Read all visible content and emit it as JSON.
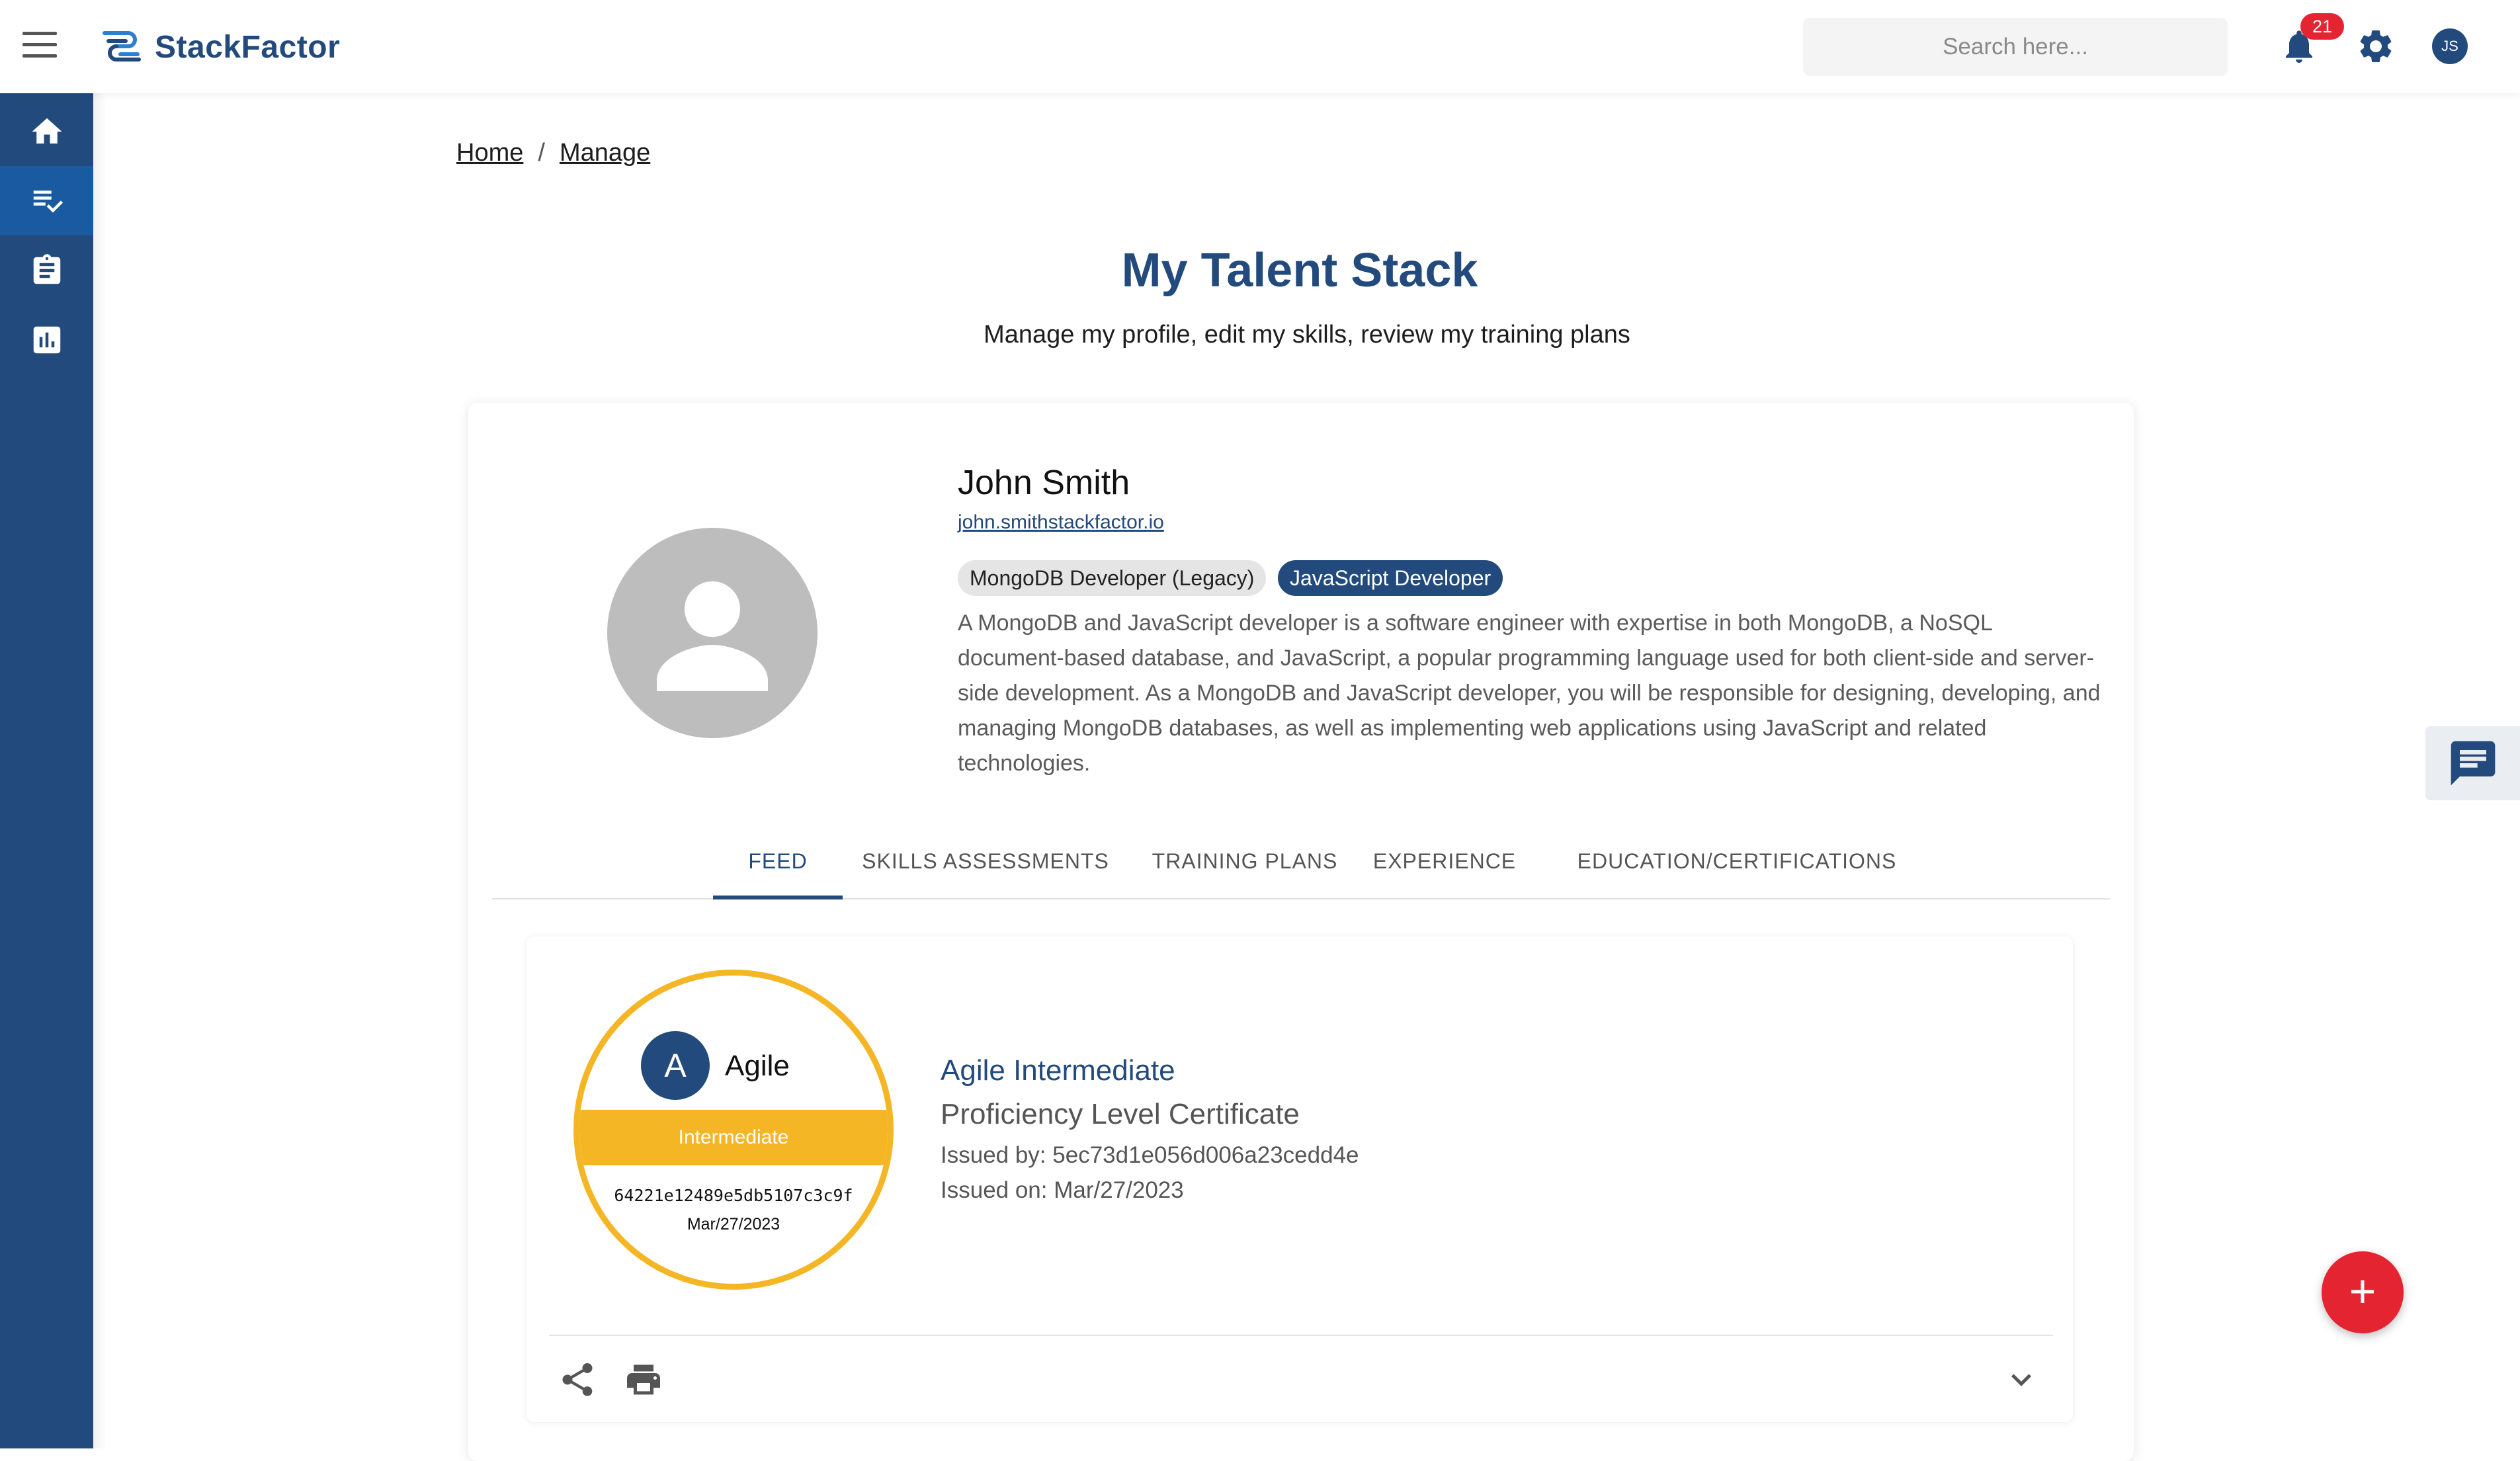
{
  "app": {
    "brand": "StackFactor",
    "search_placeholder": "Search here...",
    "notifications_count": "21",
    "user_initials": "JS",
    "colors": {
      "primary": "#234a7c",
      "accent_gold": "#f5b625",
      "danger": "#e52432"
    }
  },
  "sidebar": {
    "items": [
      {
        "icon": "home-icon",
        "active": false
      },
      {
        "icon": "playlist-check-icon",
        "active": true
      },
      {
        "icon": "clipboard-icon",
        "active": false
      },
      {
        "icon": "bar-chart-icon",
        "active": false
      }
    ]
  },
  "breadcrumb": {
    "home": "Home",
    "separator": "/",
    "current": "Manage"
  },
  "page": {
    "title": "My Talent Stack",
    "subtitle": "Manage my profile, edit my skills, review my training plans"
  },
  "profile": {
    "name": "John Smith",
    "email": "john.smithstackfactor.io",
    "roles": [
      "MongoDB Developer (Legacy)",
      "JavaScript Developer"
    ],
    "description": "A MongoDB and JavaScript developer is a software engineer with expertise in both MongoDB, a NoSQL document-based database, and JavaScript, a popular programming language used for both client-side and server-side development. As a MongoDB and JavaScript developer, you will be responsible for designing, developing, and managing MongoDB databases, as well as implementing web applications using JavaScript and related technologies."
  },
  "tabs": [
    "FEED",
    "SKILLS ASSESSMENTS",
    "TRAINING PLANS",
    "EXPERIENCE",
    "EDUCATION/CERTIFICATIONS"
  ],
  "active_tab": "FEED",
  "feed": {
    "badge": {
      "initial": "A",
      "skill": "Agile",
      "level": "Intermediate",
      "id": "64221e12489e5db5107c3c9f",
      "date": "Mar/27/2023"
    },
    "title": "Agile Intermediate",
    "subtitle": "Proficiency Level Certificate",
    "issued_by": "Issued by: 5ec73d1e056d006a23cedd4e",
    "issued_on": "Issued on: Mar/27/2023"
  },
  "fab_label": "+"
}
